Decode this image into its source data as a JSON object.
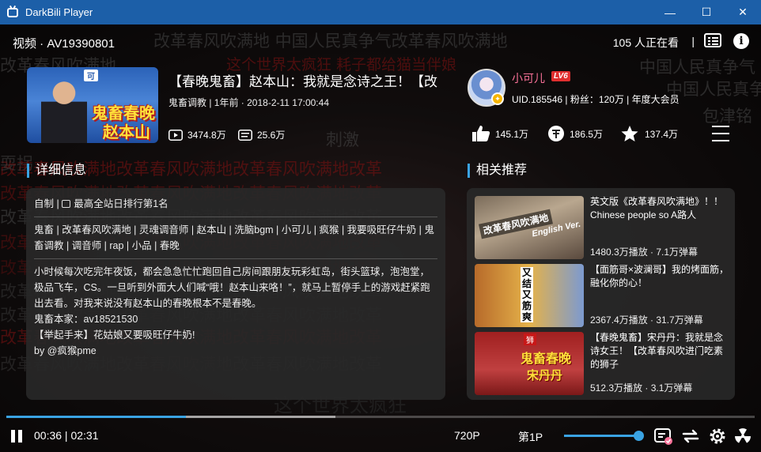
{
  "window": {
    "title": "DarkBili Player",
    "controls": {
      "minimize": "—",
      "maximize": "☐",
      "close": "✕"
    }
  },
  "header": {
    "video_id": "视频 · AV19390801",
    "viewers": "105 人正在看",
    "separator": "|"
  },
  "video": {
    "title": "【春晚鬼畜】赵本山：我就是念诗之王！【改",
    "thumb_line1": "鬼畜春晚",
    "thumb_line2": "赵本山",
    "thumb_tag": "可",
    "meta": "鬼畜调教 | 1年前 · 2018-2-11 17:00:44",
    "plays": "3474.8万",
    "danmaku": "25.6万"
  },
  "uploader": {
    "name": "小可儿",
    "level": "LV6",
    "info": "UID.185546 | 粉丝：120万 | 年度大会员"
  },
  "actions": {
    "likes": "145.1万",
    "coins": "186.5万",
    "favorites": "137.4万"
  },
  "details": {
    "heading": "详细信息",
    "rank_line_prefix": "自制 |",
    "rank_line": "最高全站日排行第1名",
    "tags": "鬼畜 | 改革春风吹满地 | 灵魂调音师 | 赵本山 | 洗脑bgm | 小可儿 | 疯猴 | 我要吸旺仔牛奶 | 鬼畜调教 | 调音师 | rap | 小品 | 春晚",
    "description": "小时候每次吃完年夜饭，都会急急忙忙跑回自己房间跟朋友玩彩虹岛，街头篮球，泡泡堂，极品飞车，CS。一旦听到外面大人们喊“哦！赵本山来咯！”，就马上暂停手上的游戏赶紧跑出去看。对我来说没有赵本山的春晚根本不是春晚。",
    "source": "鬼畜本家：av18521530",
    "quote": "【举起手来】花姑娘又要吸旺仔牛奶!",
    "by": "by @疯猴pme"
  },
  "recommend": {
    "heading": "相关推荐",
    "items": [
      {
        "title": "英文版《改革春风吹满地》！！ Chinese people so A路人",
        "stats": "1480.3万播放 · 7.1万弹幕",
        "thumb_text": "改革春风吹满地",
        "thumb_sub": "English Ver."
      },
      {
        "title": "【面筋哥×波澜哥】我的烤面筋，融化你的心！",
        "stats": "2367.4万播放 · 31.7万弹幕",
        "thumb_text": "又结又筋爽"
      },
      {
        "title": "【春晚鬼畜】宋丹丹：我就是念诗女王！【改革春风吹进门吃素的狮子",
        "stats": "512.3万播放 · 3.1万弹幕",
        "thumb_text": "鬼畜春晚",
        "thumb_sub": "宋丹丹",
        "thumb_tag": "狮"
      }
    ]
  },
  "player": {
    "current_time": "00:36",
    "duration": "02:31",
    "time_sep": " | ",
    "quality": "720P",
    "part": "第1P",
    "progress": 0.24,
    "buffered": 0.44,
    "volume": 1.0
  },
  "background_danmaku": [
    "改革春风吹满地 中国人民真争气改革春风吹满地",
    "改革春风吹满地",
    "这个世界太疯狂 耗子都给猫当伴娘",
    "中国人民真争气",
    "中国人民真争",
    "包津铭",
    "改革春风吹满地改革春风吹满地改革春风吹满地改革",
    "耍拐",
    "刺激",
    "这个世界太疯狂"
  ]
}
